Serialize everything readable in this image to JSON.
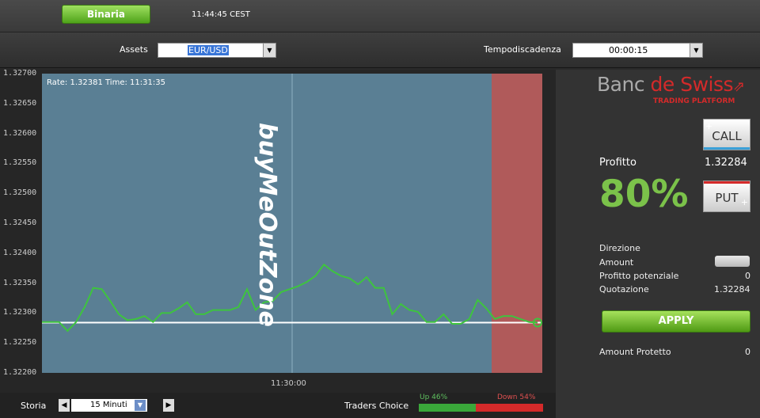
{
  "header": {
    "mode_button": "Binaria",
    "clock": "11:44:45 CEST"
  },
  "selectors": {
    "assets_label": "Assets",
    "asset_value": "EUR/USD",
    "expiry_label": "Tempodiscadenza",
    "expiry_value": "00:00:15"
  },
  "chart": {
    "rate_text": "Rate: 1.32381 Time: 11:31:35",
    "watermark": "buyMeOutZone",
    "y_ticks": [
      "1.32700",
      "1.32650",
      "1.32600",
      "1.32550",
      "1.32500",
      "1.32450",
      "1.32400",
      "1.32350",
      "1.32300",
      "1.32250",
      "1.32200"
    ],
    "x_tick": "11:30:00"
  },
  "chart_data": {
    "type": "line",
    "ylim": [
      1.322,
      1.327
    ],
    "series": [
      {
        "values": [
          1.32285,
          1.32285,
          1.32285,
          1.3227,
          1.32285,
          1.3231,
          1.32342,
          1.3234,
          1.3232,
          1.32298,
          1.32288,
          1.3229,
          1.32295,
          1.32285,
          1.323,
          1.323,
          1.32308,
          1.32318,
          1.32298,
          1.32298,
          1.32305,
          1.32305,
          1.32305,
          1.3231,
          1.3234,
          1.32305,
          1.32318,
          1.3232,
          1.32335,
          1.3234,
          1.32345,
          1.32352,
          1.32362,
          1.32381,
          1.3237,
          1.32362,
          1.32358,
          1.32348,
          1.3236,
          1.32342,
          1.32342,
          1.32298,
          1.32315,
          1.32305,
          1.32302,
          1.32285,
          1.32285,
          1.32298,
          1.32282,
          1.32282,
          1.3229,
          1.32322,
          1.32308,
          1.3229,
          1.32295,
          1.32295,
          1.3229,
          1.32285,
          1.32284
        ]
      }
    ],
    "reference_line": 1.32284
  },
  "sidebar": {
    "brand_main": "Banc ",
    "brand_accent": "de Swiss",
    "brand_sub": "TRADING PLATFORM",
    "call_label": "CALL",
    "put_label": "PUT",
    "profit_label": "Profitto",
    "profit_rate": "1.32284",
    "profit_percent": "80%",
    "direzione_label": "Direzione",
    "amount_label": "Amount",
    "profitto_potenziale_label": "Profitto potenziale",
    "profitto_potenziale_value": "0",
    "quotazione_label": "Quotazione",
    "quotazione_value": "1.32284",
    "apply_label": "APPLY",
    "amount_protetto_label": "Amount Protetto",
    "amount_protetto_value": "0"
  },
  "bottom": {
    "storia_label": "Storia",
    "storia_value": "15 Minuti",
    "traders_choice_label": "Traders Choice",
    "up_label": "Up 46%",
    "down_label": "Down 54%",
    "up_fraction": 0.46
  },
  "colors": {
    "plot_bg": "#5a7f94",
    "expiry_zone": "#b05a5a",
    "line": "#3ec43e",
    "accent_red": "#d42a2a",
    "profit_green": "#7bc24a"
  }
}
